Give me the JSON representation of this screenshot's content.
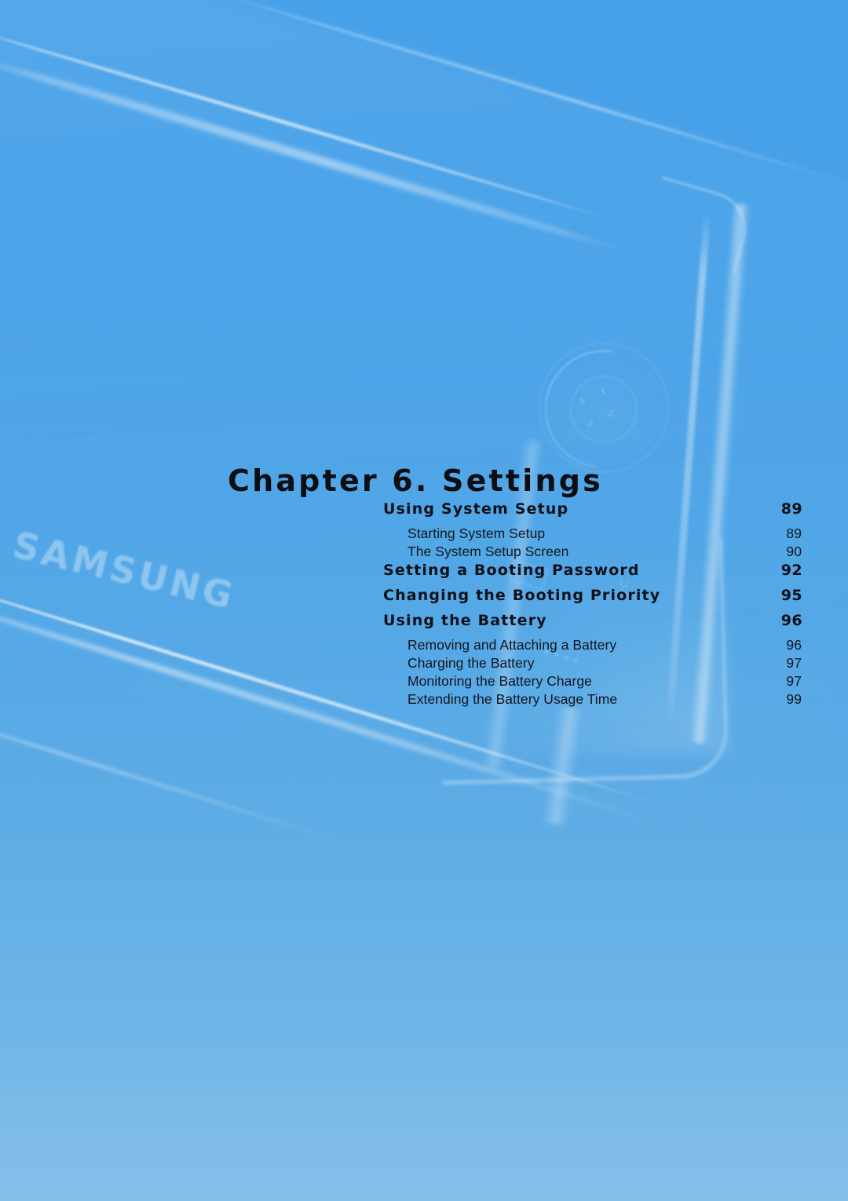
{
  "document": {
    "chapter_title": "Chapter 6. Settings",
    "brand_watermark": "SAMSUNG"
  },
  "toc": {
    "entries": [
      {
        "level": "main",
        "label": "Using System Setup",
        "page": "89"
      },
      {
        "level": "sub",
        "label": "Starting System Setup",
        "page": "89"
      },
      {
        "level": "sub",
        "label": "The System Setup Screen",
        "page": "90"
      },
      {
        "level": "main",
        "label": "Setting a Booting Password",
        "page": "92"
      },
      {
        "level": "main",
        "label": "Changing the Booting Priority",
        "page": "95"
      },
      {
        "level": "main",
        "label": "Using the Battery",
        "page": "96"
      },
      {
        "level": "sub",
        "label": "Removing and Attaching a Battery",
        "page": "96"
      },
      {
        "level": "sub",
        "label": "Charging the Battery",
        "page": "97"
      },
      {
        "level": "sub",
        "label": "Monitoring the Battery Charge",
        "page": "97"
      },
      {
        "level": "sub",
        "label": "Extending the Battery Usage Time",
        "page": "99"
      }
    ]
  },
  "artwork": {
    "subject": "samsung-laptop-photograph",
    "ring_marks": [
      "1",
      "2",
      "3",
      "4"
    ],
    "usb_glyph": "⑂"
  },
  "colors": {
    "background_top": "#45a0e8",
    "background_bottom": "#84bfea",
    "text": "#101018",
    "watermark": "#ffffff"
  }
}
